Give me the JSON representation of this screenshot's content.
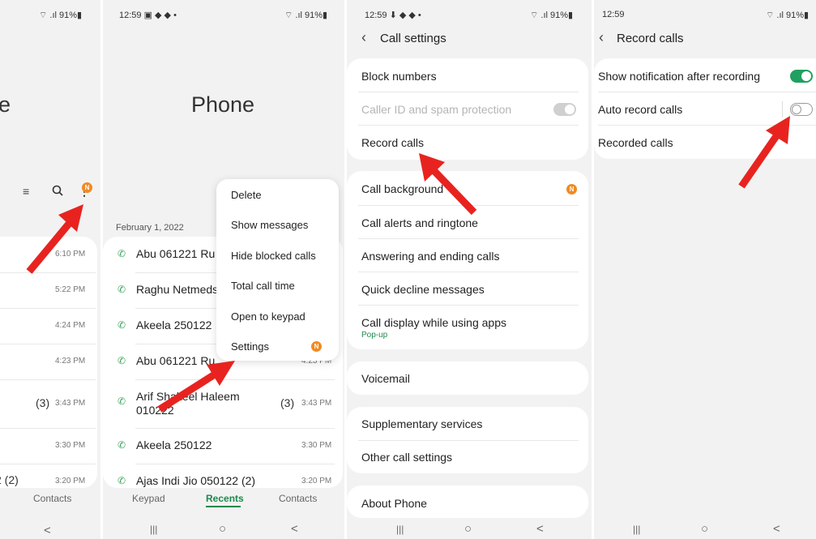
{
  "colors": {
    "accent_green": "#1a8a4a",
    "badge_orange": "#f08a24",
    "arrow_red": "#e8231f",
    "toggle_on": "#20a060"
  },
  "panel1": {
    "status_right": "⌔ .ıl 91%▮",
    "title_partial": "e",
    "icons": [
      "filter-icon",
      "search-icon",
      "more-icon"
    ],
    "badge": "N",
    "times": [
      "6:10 PM",
      "5:22 PM",
      "4:24 PM",
      "4:23 PM",
      "3:43 PM",
      "3:30 PM",
      "3:20 PM"
    ],
    "count": "(3)",
    "partial_row": "2 (2)",
    "tab_contacts": "Contacts"
  },
  "panel2": {
    "status_left": "12:59 ▣ ◆ ◆ •",
    "status_right": "⌔ .ıl 91%▮",
    "title": "Phone",
    "date_header": "February 1, 2022",
    "calls": [
      {
        "name": "Abu 061221 Ru",
        "time": "",
        "count": ""
      },
      {
        "name": "Raghu Netmeds",
        "time": "",
        "count": ""
      },
      {
        "name": "Akeela 250122",
        "time": "",
        "count": ""
      },
      {
        "name": "Abu 061221 Ru",
        "time": "4:23 PM",
        "count": ""
      },
      {
        "name": "Arif Shakeel Haleem",
        "name2": "010222",
        "time": "3:43 PM",
        "count": "(3)"
      },
      {
        "name": "Akeela 250122",
        "time": "3:30 PM",
        "count": ""
      },
      {
        "name": "Ajas Indi  Jio 050122 (2)",
        "time": "3:20 PM",
        "count": ""
      }
    ],
    "menu": [
      "Delete",
      "Show messages",
      "Hide blocked calls",
      "Total call time",
      "Open to keypad",
      "Settings"
    ],
    "menu_badge": "N",
    "tabs": [
      "Keypad",
      "Recents",
      "Contacts"
    ]
  },
  "panel3": {
    "status_left": "12:59 ⬇ ◆ ◆ •",
    "status_right": "⌔ .ıl 91%▮",
    "header": "Call settings",
    "group1": [
      "Block numbers",
      "Caller ID and spam protection",
      "Record calls"
    ],
    "group2": [
      "Call background",
      "Call alerts and ringtone",
      "Answering and ending calls",
      "Quick decline messages",
      "Call display while using apps"
    ],
    "popup_sub": "Pop-up",
    "badge": "N",
    "voicemail": "Voicemail",
    "group3": [
      "Supplementary services",
      "Other call settings"
    ],
    "about": "About Phone"
  },
  "panel4": {
    "status_left": "12:59",
    "status_right": "⌔ .ıl 91%▮",
    "header": "Record calls",
    "rows": [
      "Show notification after recording",
      "Auto record calls",
      "Recorded calls"
    ],
    "toggle_show_notification": true,
    "toggle_auto_record": false
  },
  "nav": {
    "recents": "|||",
    "home": "○",
    "back": "<"
  }
}
